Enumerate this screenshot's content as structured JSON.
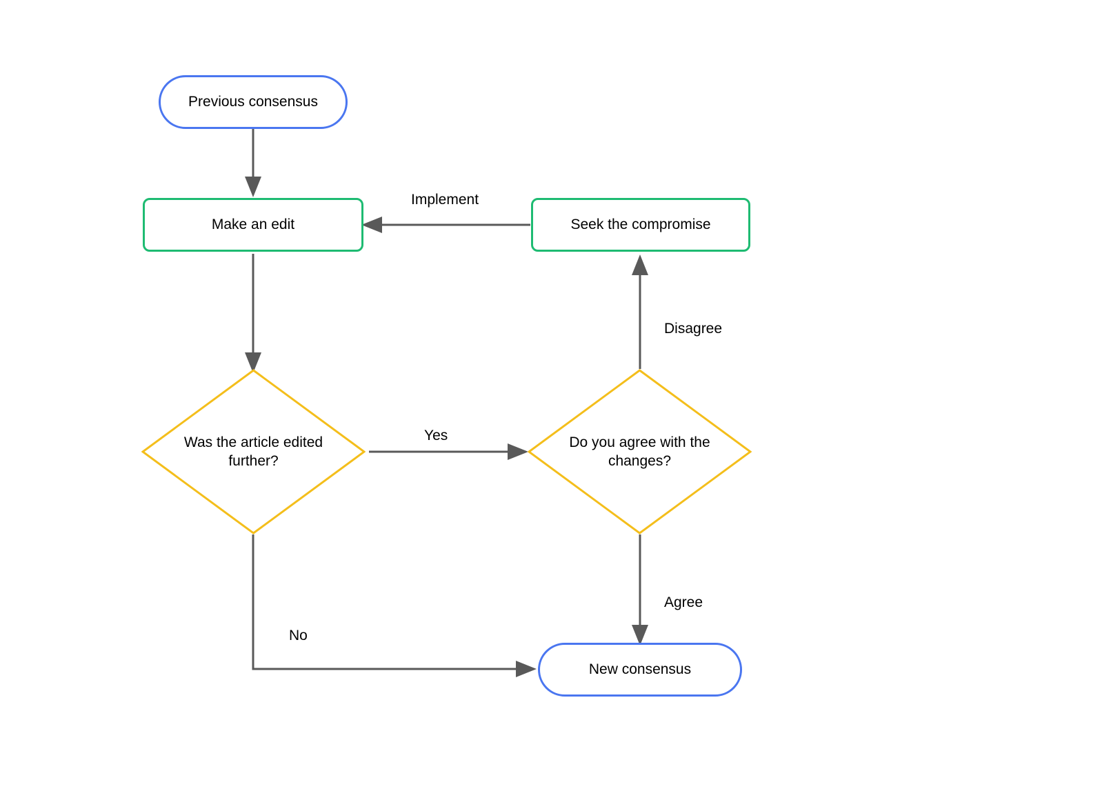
{
  "nodes": {
    "start": {
      "text": "Previous consensus"
    },
    "make_edit": {
      "text": "Make an edit"
    },
    "compromise": {
      "text": "Seek the compromise"
    },
    "edited_further": {
      "text": "Was the article edited further?"
    },
    "agree_changes": {
      "text": "Do you agree with the changes?"
    },
    "end": {
      "text": "New consensus"
    }
  },
  "edges": {
    "implement": {
      "text": "Implement"
    },
    "yes": {
      "text": "Yes"
    },
    "no": {
      "text": "No"
    },
    "disagree": {
      "text": "Disagree"
    },
    "agree": {
      "text": "Agree"
    }
  },
  "colors": {
    "terminal_border": "#4A76F0",
    "process_border": "#1EBB72",
    "decision_border": "#F4BE1B",
    "arrow": "#595959"
  }
}
